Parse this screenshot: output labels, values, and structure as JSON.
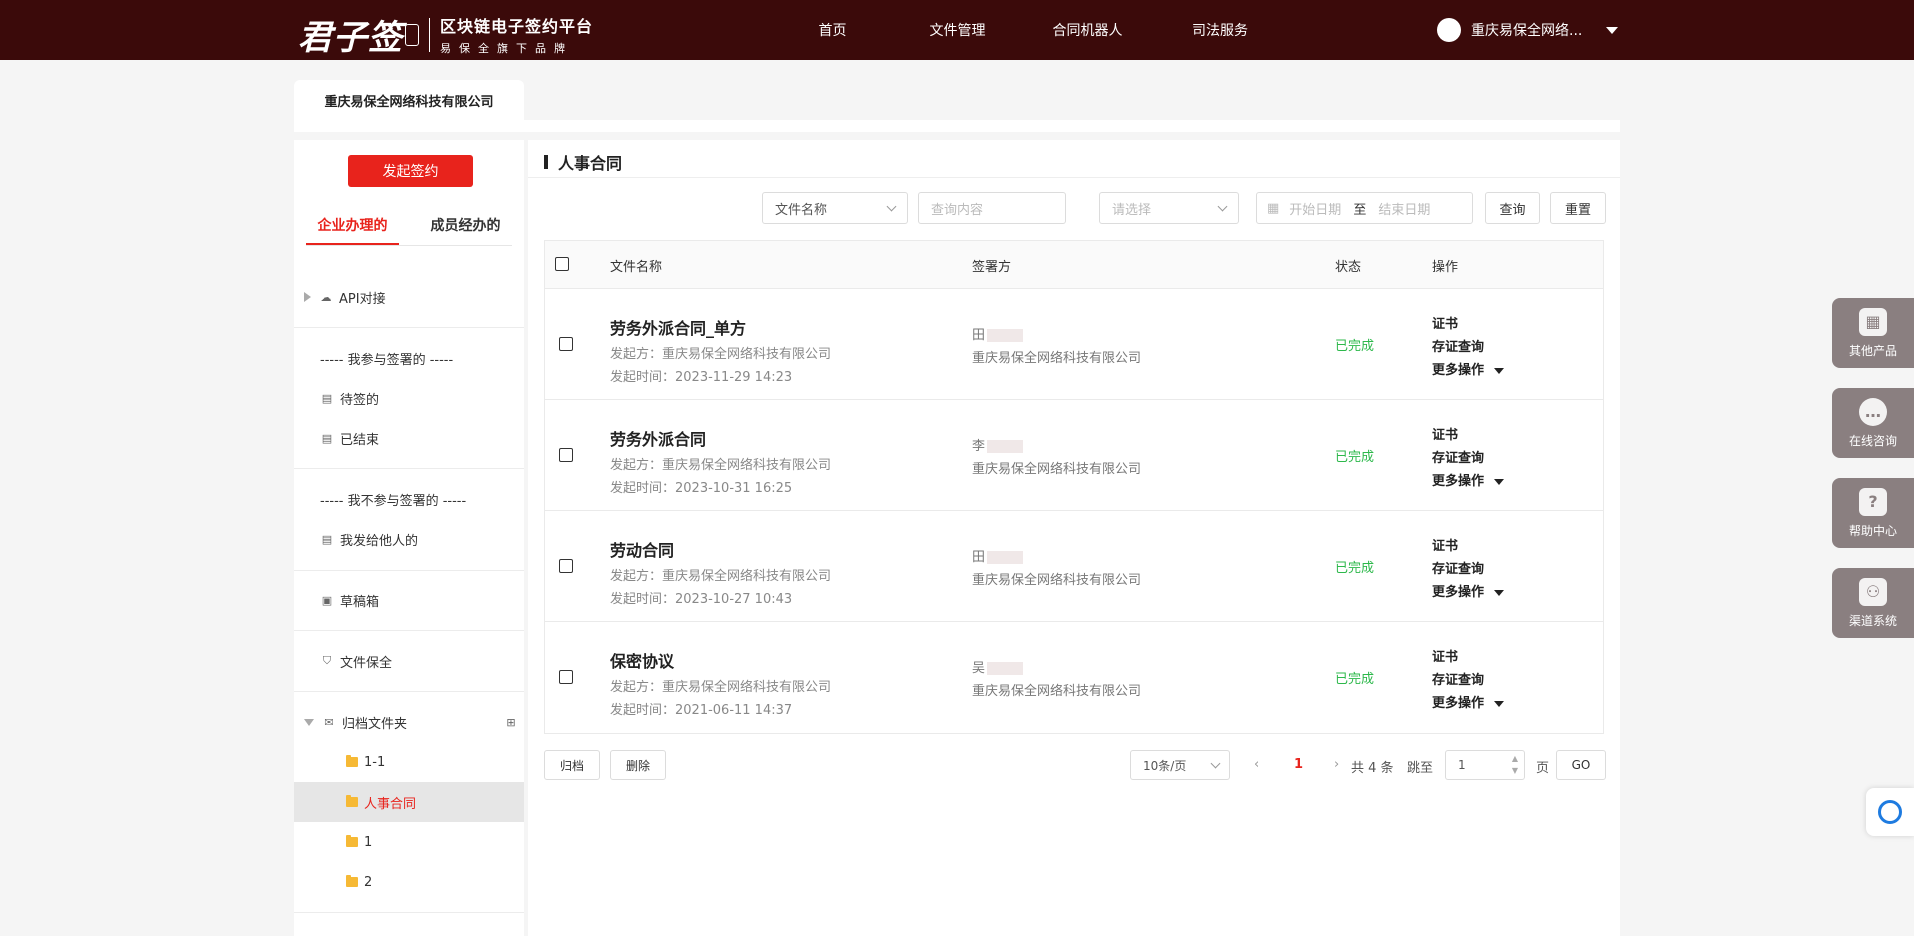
{
  "brand": {
    "logo_main": "君子签",
    "line1": "区块链电子签约平台",
    "line2": "易保全旗下品牌"
  },
  "nav": {
    "home": "首页",
    "files": "文件管理",
    "robot": "合同机器人",
    "judicial": "司法服务"
  },
  "user": {
    "name": "重庆易保全网络..."
  },
  "company_tab": "重庆易保全网络科技有限公司",
  "sidebar": {
    "start_sign": "发起签约",
    "tabs": {
      "enterprise": "企业办理的",
      "member": "成员经办的"
    },
    "api": "API对接",
    "group_participate": "----- 我参与签署的 -----",
    "pending": "待签的",
    "finished": "已结束",
    "group_not_participate": "----- 我不参与签署的 -----",
    "sent_to_others": "我发给他人的",
    "drafts": "草稿箱",
    "file_security": "文件保全",
    "archive_folder": "归档文件夹",
    "folders": [
      "1-1",
      "人事合同",
      "1",
      "2"
    ]
  },
  "main": {
    "title": "人事合同",
    "filters": {
      "field_select": "文件名称",
      "query_placeholder": "查询内容",
      "status_placeholder": "请选择",
      "start_date": "开始日期",
      "to": "至",
      "end_date": "结束日期",
      "search": "查询",
      "reset": "重置"
    },
    "columns": {
      "name": "文件名称",
      "signer": "签署方",
      "status": "状态",
      "actions": "操作"
    },
    "rows": [
      {
        "title": "劳务外派合同_单方",
        "initiator": "发起方：重庆易保全网络科技有限公司",
        "time": "发起时间：2023-11-29 14:23",
        "signer_name": "田",
        "signer_org": "重庆易保全网络科技有限公司",
        "status": "已完成"
      },
      {
        "title": "劳务外派合同",
        "initiator": "发起方：重庆易保全网络科技有限公司",
        "time": "发起时间：2023-10-31 16:25",
        "signer_name": "李",
        "signer_org": "重庆易保全网络科技有限公司",
        "status": "已完成"
      },
      {
        "title": "劳动合同",
        "initiator": "发起方：重庆易保全网络科技有限公司",
        "time": "发起时间：2023-10-27 10:43",
        "signer_name": "田",
        "signer_org": "重庆易保全网络科技有限公司",
        "status": "已完成"
      },
      {
        "title": "保密协议",
        "initiator": "发起方：重庆易保全网络科技有限公司",
        "time": "发起时间：2021-06-11 14:37",
        "signer_name": "吴",
        "signer_org": "重庆易保全网络科技有限公司",
        "status": "已完成"
      }
    ],
    "row_actions": {
      "cert": "证书",
      "evidence": "存证查询",
      "more": "更多操作"
    },
    "footer": {
      "archive": "归档",
      "delete": "删除",
      "page_size": "10条/页",
      "current_page": "1",
      "total": "共 4 条",
      "jump_to": "跳至",
      "page_input": "1",
      "page_unit": "页",
      "go": "GO"
    }
  },
  "floating": {
    "other_products": "其他产品",
    "online_consult": "在线咨询",
    "help_center": "帮助中心",
    "channel_system": "渠道系统"
  },
  "colors": {
    "nav_bg": "#3b0a0a",
    "accent": "#e8231c",
    "success": "#2db84b"
  }
}
